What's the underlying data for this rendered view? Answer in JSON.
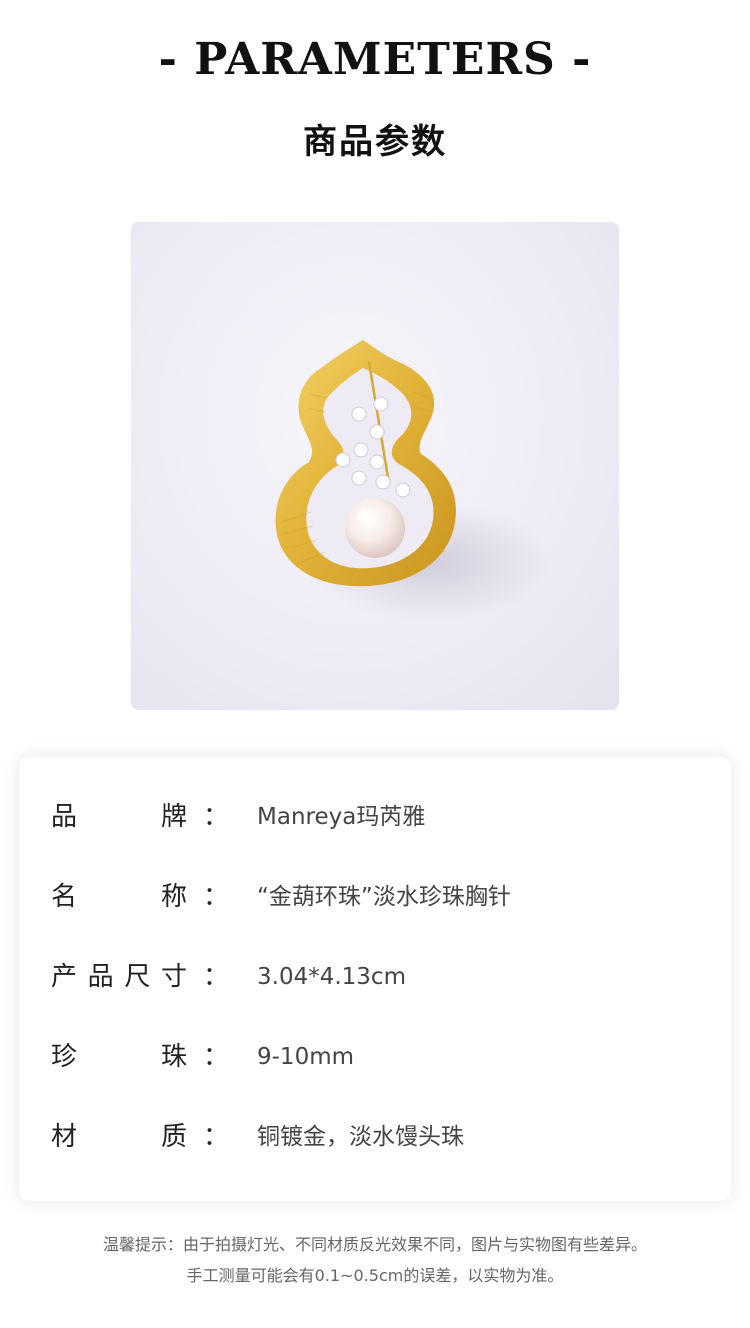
{
  "header": {
    "title_en": "- PARAMETERS -",
    "title_cn": "商品参数"
  },
  "photo": {
    "subject": "gourd-brooch-photo",
    "colors": {
      "background": "#ece9f3",
      "gold": "#e2b43a",
      "pearl": "#f6ece8"
    }
  },
  "parameters": [
    {
      "label_chars": [
        "品",
        "牌"
      ],
      "colon": "：",
      "value": "Manreya玛芮雅"
    },
    {
      "label_chars": [
        "名",
        "称"
      ],
      "colon": "：",
      "value": "“金葫环珠”淡水珍珠胸针"
    },
    {
      "label_chars": [
        "产",
        "品",
        "尺",
        "寸"
      ],
      "colon": "：",
      "value": "3.04*4.13cm"
    },
    {
      "label_chars": [
        "珍",
        "珠"
      ],
      "colon": "：",
      "value": "9-10mm"
    },
    {
      "label_chars": [
        "材",
        "质"
      ],
      "colon": "：",
      "value": "铜镀金，淡水馒头珠"
    }
  ],
  "notice": {
    "line1": "温馨提示：由于拍摄灯光、不同材质反光效果不同，图片与实物图有些差异。",
    "line2": "手工测量可能会有0.1~0.5cm的误差，以实物为准。"
  }
}
